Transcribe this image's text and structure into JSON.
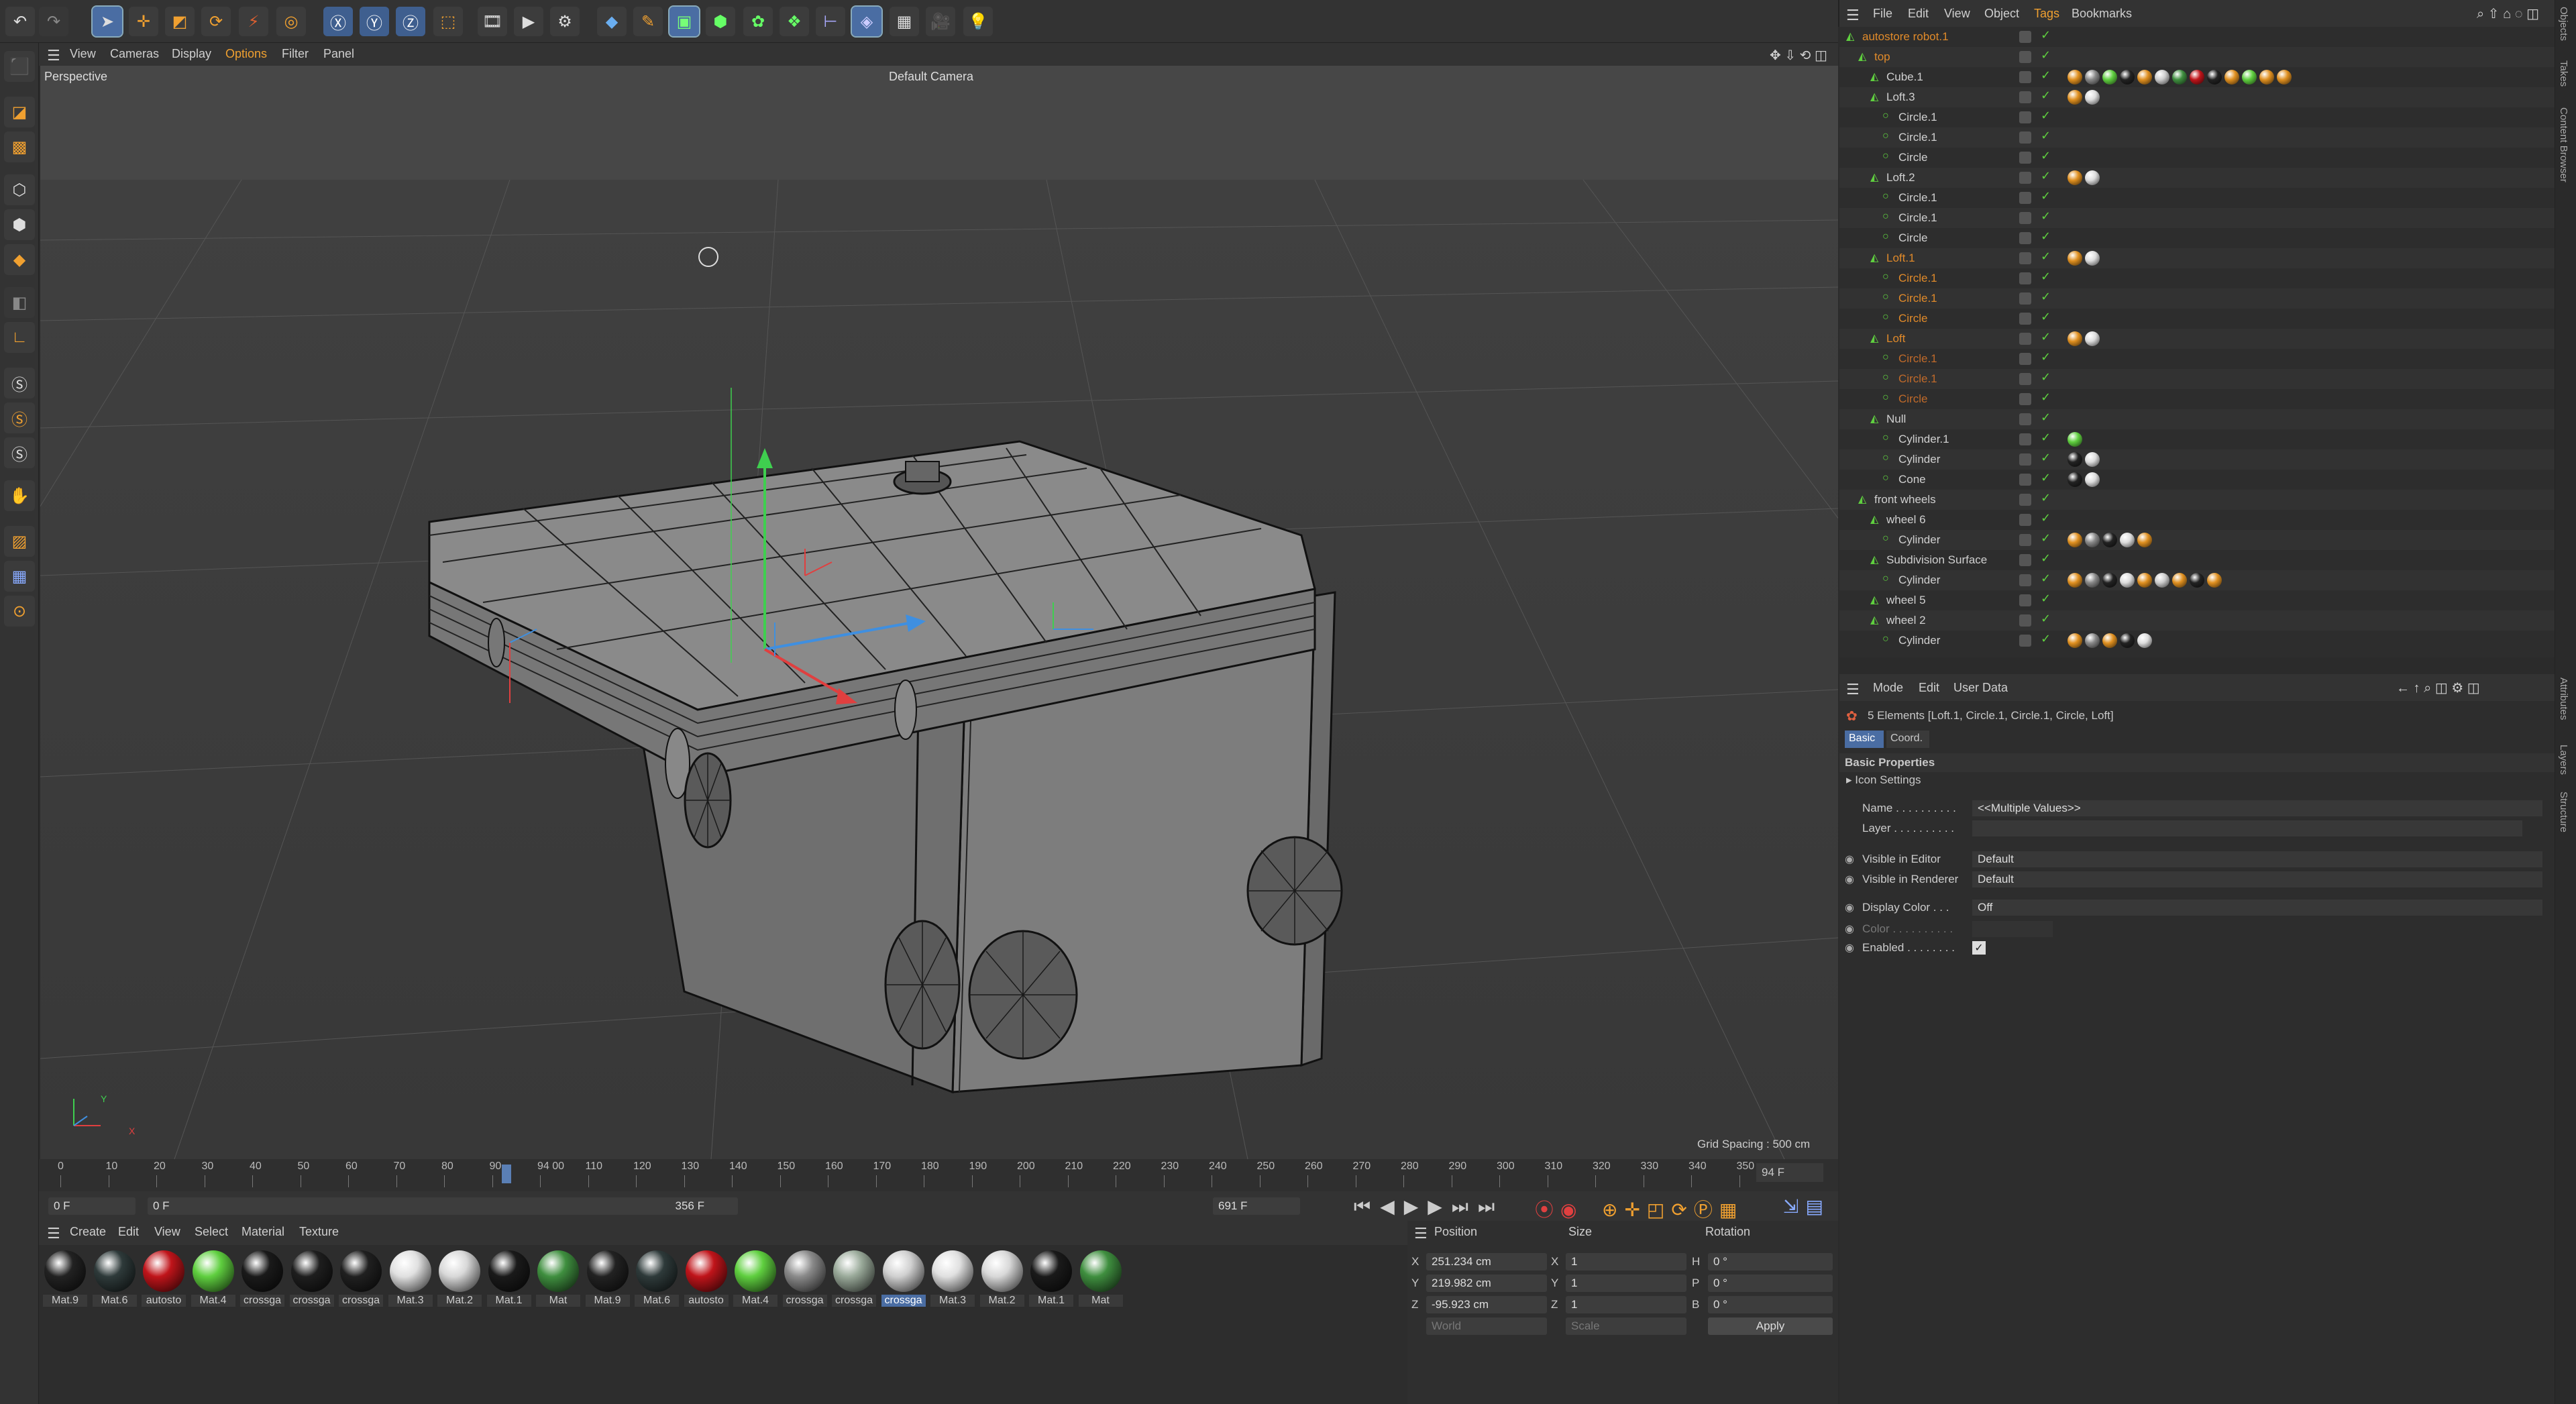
{
  "viewport": {
    "menu": [
      "View",
      "Cameras",
      "Display",
      "Options",
      "Filter",
      "Panel"
    ],
    "label": "Perspective",
    "camera": "Default Camera",
    "grid_spacing": "Grid Spacing : 500 cm"
  },
  "timeline": {
    "ticks": [
      "0",
      "10",
      "20",
      "30",
      "40",
      "50",
      "60",
      "70",
      "80",
      "90",
      "94 00",
      "110",
      "120",
      "130",
      "140",
      "150",
      "160",
      "170",
      "180",
      "190",
      "200",
      "210",
      "220",
      "230",
      "240",
      "250",
      "260",
      "270",
      "280",
      "290",
      "300",
      "310",
      "320",
      "330",
      "340",
      "350"
    ],
    "end_label": "94 F",
    "start_frame": "0 F",
    "current_frame": "0 F",
    "range_end": "356 F",
    "max_frame": "691 F"
  },
  "materials": {
    "menu": [
      "Create",
      "Edit",
      "View",
      "Select",
      "Material",
      "Texture"
    ],
    "items": [
      {
        "label": "Mat.9",
        "color": "#222222"
      },
      {
        "label": "Mat.6",
        "color": "#2e3a3a"
      },
      {
        "label": "autosto",
        "color": "#c0141a"
      },
      {
        "label": "Mat.4",
        "color": "#5fcf3f"
      },
      {
        "label": "crossga",
        "color": "#1a1a1a"
      },
      {
        "label": "crossga",
        "color": "#1e1e1e"
      },
      {
        "label": "crossga",
        "color": "#202020"
      },
      {
        "label": "Mat.3",
        "color": "#e0e0e0"
      },
      {
        "label": "Mat.2",
        "color": "#d8d8d8"
      },
      {
        "label": "Mat.1",
        "color": "#1a1a1a"
      },
      {
        "label": "Mat",
        "color": "#3f8f3f"
      },
      {
        "label": "Mat.9",
        "color": "#222222"
      },
      {
        "label": "Mat.6",
        "color": "#2e3a3a"
      },
      {
        "label": "autosto",
        "color": "#c0141a"
      },
      {
        "label": "Mat.4",
        "color": "#5fcf3f"
      },
      {
        "label": "crossga",
        "color": "#8a8a8a"
      },
      {
        "label": "crossga",
        "color": "#9aaa9a"
      },
      {
        "label": "crossga",
        "color": "#d0d0d0"
      },
      {
        "label": "Mat.3",
        "color": "#e0e0e0"
      },
      {
        "label": "Mat.2",
        "color": "#d8d8d8"
      },
      {
        "label": "Mat.1",
        "color": "#1a1a1a"
      },
      {
        "label": "Mat",
        "color": "#3f8f3f"
      }
    ]
  },
  "coords": {
    "headers": {
      "position": "Position",
      "size": "Size",
      "rotation": "Rotation"
    },
    "rows": [
      {
        "axis": "X",
        "pos": "251.234 cm",
        "saxis": "X",
        "size": "1",
        "raxis": "H",
        "rot": "0 °"
      },
      {
        "axis": "Y",
        "pos": "219.982 cm",
        "saxis": "Y",
        "size": "1",
        "raxis": "P",
        "rot": "0 °"
      },
      {
        "axis": "Z",
        "pos": "-95.923 cm",
        "saxis": "Z",
        "size": "1",
        "raxis": "B",
        "rot": "0 °"
      }
    ],
    "mode": "World",
    "scale": "Scale",
    "apply": "Apply"
  },
  "object_manager": {
    "menu": [
      "File",
      "Edit",
      "View",
      "Object",
      "Tags",
      "Bookmarks"
    ],
    "rows": [
      {
        "name": "autostore robot.1",
        "indent": 0,
        "color": "#e08a2a",
        "tags": []
      },
      {
        "name": "top",
        "indent": 1,
        "color": "#e08a2a",
        "tags": []
      },
      {
        "name": "Cube.1",
        "indent": 2,
        "color": "#d0d0d0",
        "tags": [
          "#e09020",
          "#888888",
          "#5fcf3f",
          "#222222",
          "#e09020",
          "#cccccc",
          "#3f8f3f",
          "#c0141a",
          "#222222",
          "#e09020",
          "#5fcf3f",
          "#e09020",
          "#e09020"
        ]
      },
      {
        "name": "Loft.3",
        "indent": 2,
        "color": "#d0d0d0",
        "tags": [
          "#e09020",
          "#dddddd"
        ]
      },
      {
        "name": "Circle.1",
        "indent": 3,
        "color": "#d0d0d0",
        "tags": []
      },
      {
        "name": "Circle.1",
        "indent": 3,
        "color": "#d0d0d0",
        "tags": []
      },
      {
        "name": "Circle",
        "indent": 3,
        "color": "#d0d0d0",
        "tags": []
      },
      {
        "name": "Loft.2",
        "indent": 2,
        "color": "#d0d0d0",
        "tags": [
          "#e09020",
          "#dddddd"
        ]
      },
      {
        "name": "Circle.1",
        "indent": 3,
        "color": "#d0d0d0",
        "tags": []
      },
      {
        "name": "Circle.1",
        "indent": 3,
        "color": "#d0d0d0",
        "tags": []
      },
      {
        "name": "Circle",
        "indent": 3,
        "color": "#d0d0d0",
        "tags": []
      },
      {
        "name": "Loft.1",
        "indent": 2,
        "color": "#e08a2a",
        "tags": [
          "#e09020",
          "#dddddd"
        ]
      },
      {
        "name": "Circle.1",
        "indent": 3,
        "color": "#e08a2a",
        "tags": []
      },
      {
        "name": "Circle.1",
        "indent": 3,
        "color": "#e08a2a",
        "tags": []
      },
      {
        "name": "Circle",
        "indent": 3,
        "color": "#e08a2a",
        "tags": []
      },
      {
        "name": "Loft",
        "indent": 2,
        "color": "#e08a2a",
        "tags": [
          "#e09020",
          "#dddddd"
        ]
      },
      {
        "name": "Circle.1",
        "indent": 3,
        "color": "#c06a2a",
        "tags": []
      },
      {
        "name": "Circle.1",
        "indent": 3,
        "color": "#c06a2a",
        "tags": []
      },
      {
        "name": "Circle",
        "indent": 3,
        "color": "#c06a2a",
        "tags": []
      },
      {
        "name": "Null",
        "indent": 2,
        "color": "#d0d0d0",
        "tags": []
      },
      {
        "name": "Cylinder.1",
        "indent": 3,
        "color": "#d0d0d0",
        "tags": [
          "#5fcf3f"
        ]
      },
      {
        "name": "Cylinder",
        "indent": 3,
        "color": "#d0d0d0",
        "tags": [
          "#222222",
          "#dddddd"
        ]
      },
      {
        "name": "Cone",
        "indent": 3,
        "color": "#d0d0d0",
        "tags": [
          "#222222",
          "#dddddd"
        ]
      },
      {
        "name": "front wheels",
        "indent": 1,
        "color": "#d0d0d0",
        "tags": []
      },
      {
        "name": "wheel 6",
        "indent": 2,
        "color": "#d0d0d0",
        "tags": []
      },
      {
        "name": "Cylinder",
        "indent": 3,
        "color": "#d0d0d0",
        "tags": [
          "#e09020",
          "#888888",
          "#222222",
          "#dddddd",
          "#e09020"
        ]
      },
      {
        "name": "Subdivision Surface",
        "indent": 2,
        "color": "#d0d0d0",
        "tags": []
      },
      {
        "name": "Cylinder",
        "indent": 3,
        "color": "#d0d0d0",
        "tags": [
          "#e09020",
          "#888888",
          "#222222",
          "#dddddd",
          "#e09020",
          "#cccccc",
          "#e09020",
          "#222222",
          "#e09020"
        ]
      },
      {
        "name": "wheel 5",
        "indent": 2,
        "color": "#d0d0d0",
        "tags": []
      },
      {
        "name": "wheel 2",
        "indent": 2,
        "color": "#d0d0d0",
        "tags": []
      },
      {
        "name": "Cylinder",
        "indent": 3,
        "color": "#d0d0d0",
        "tags": [
          "#e09020",
          "#888888",
          "#e09020",
          "#222222",
          "#dddddd"
        ]
      }
    ]
  },
  "attributes": {
    "menu": [
      "Mode",
      "Edit",
      "User Data"
    ],
    "summary": "5 Elements [Loft.1, Circle.1, Circle.1, Circle, Loft]",
    "tabs": [
      "Basic",
      "Coord."
    ],
    "section": "Basic Properties",
    "icon_settings": "Icon Settings",
    "fields": [
      {
        "label": "Name . . . . . . . . . .",
        "value": "<<Multiple Values>>"
      },
      {
        "label": "Layer . . . . . . . . . .",
        "value": ""
      },
      {
        "label": "Visible in Editor",
        "value": "Default"
      },
      {
        "label": "Visible in Renderer",
        "value": "Default"
      },
      {
        "label": "Display Color . . .",
        "value": "Off"
      },
      {
        "label": "Color . . . . . . . . . .",
        "value": ""
      },
      {
        "label": "Enabled . . . . . . . .",
        "value": ""
      }
    ]
  },
  "side_tabs": [
    "Objects",
    "Takes",
    "Content Browser",
    "Attributes",
    "Layers",
    "Structure"
  ]
}
